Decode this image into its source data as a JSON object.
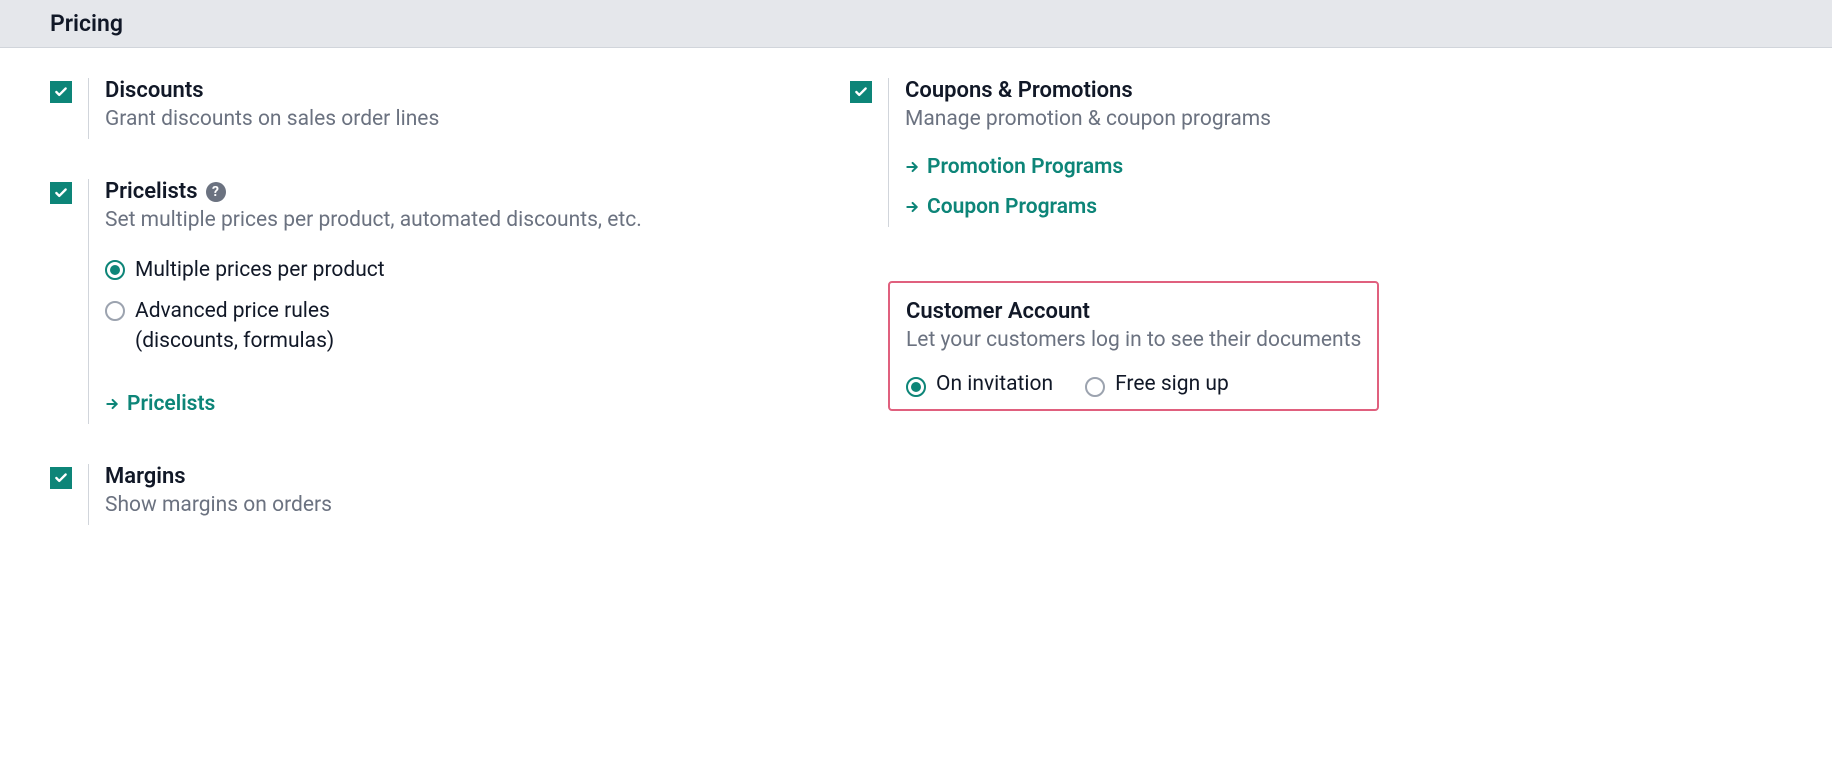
{
  "section": {
    "title": "Pricing"
  },
  "discounts": {
    "title": "Discounts",
    "desc": "Grant discounts on sales order lines"
  },
  "pricelists": {
    "title": "Pricelists",
    "desc": "Set multiple prices per product, automated discounts, etc.",
    "option_multiple": "Multiple prices per product",
    "option_advanced": "Advanced price rules (discounts, formulas)",
    "link": "Pricelists"
  },
  "margins": {
    "title": "Margins",
    "desc": "Show margins on orders"
  },
  "coupons": {
    "title": "Coupons & Promotions",
    "desc": "Manage promotion & coupon programs",
    "link_promotion": "Promotion Programs",
    "link_coupon": "Coupon Programs"
  },
  "customer_account": {
    "title": "Customer Account",
    "desc": "Let your customers log in to see their documents",
    "option_invitation": "On invitation",
    "option_free": "Free sign up"
  }
}
